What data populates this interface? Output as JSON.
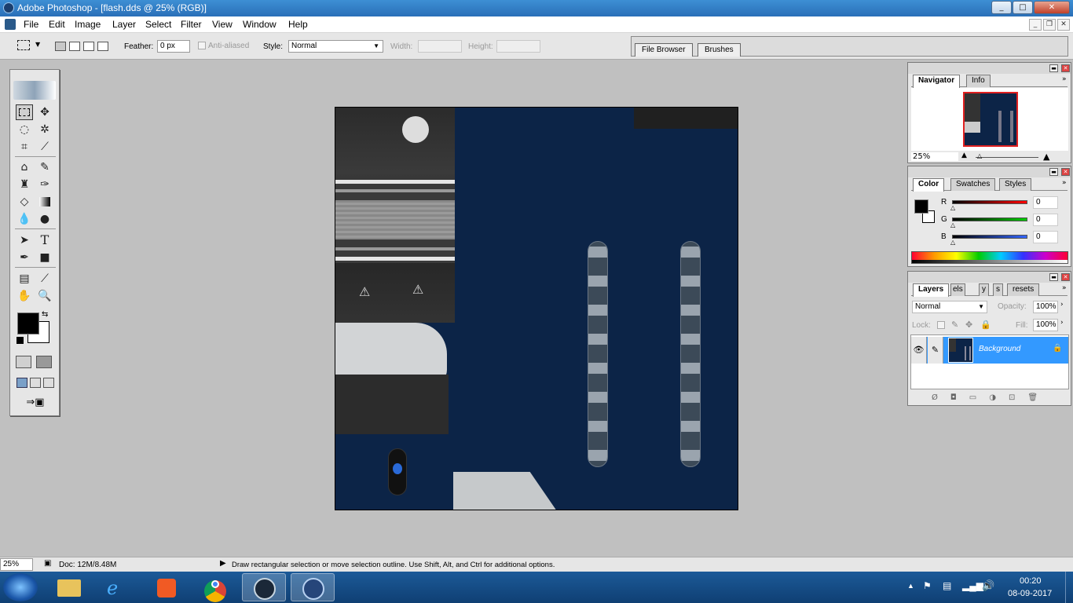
{
  "window": {
    "title": "Adobe Photoshop - [flash.dds @ 25% (RGB)]",
    "controls": [
      "_",
      "□",
      "✕"
    ]
  },
  "menu": [
    "File",
    "Edit",
    "Image",
    "Layer",
    "Select",
    "Filter",
    "View",
    "Window",
    "Help"
  ],
  "options": {
    "feather_label": "Feather:",
    "feather_value": "0 px",
    "antialiased_label": "Anti-aliased",
    "style_label": "Style:",
    "style_value": "Normal",
    "width_label": "Width:",
    "height_label": "Height:"
  },
  "palette_well": {
    "tabs": [
      "File Browser",
      "Brushes"
    ]
  },
  "navigator": {
    "tabs": [
      "Navigator",
      "Info"
    ],
    "zoom": "25%"
  },
  "color": {
    "tabs": [
      "Color",
      "Swatches",
      "Styles"
    ],
    "channels": [
      {
        "label": "R",
        "value": "0"
      },
      {
        "label": "G",
        "value": "0"
      },
      {
        "label": "B",
        "value": "0"
      }
    ]
  },
  "layers": {
    "tabs": [
      "Layers",
      "els",
      "y",
      "s",
      "resets"
    ],
    "blend_mode": "Normal",
    "opacity_label": "Opacity:",
    "opacity_value": "100%",
    "lock_label": "Lock:",
    "fill_label": "Fill:",
    "fill_value": "100%",
    "layer_name": "Background"
  },
  "status": {
    "zoom": "25%",
    "doc": "Doc: 12M/8.48M",
    "hint": "Draw rectangular selection or move selection outline.  Use Shift, Alt, and Ctrl for additional options."
  },
  "taskbar": {
    "time": "00:20",
    "date": "08-09-2017"
  },
  "colors": {
    "canvas_blue": "#0c2447",
    "title_blue": "#2a6fb8",
    "layer_selected": "#3399ff"
  }
}
